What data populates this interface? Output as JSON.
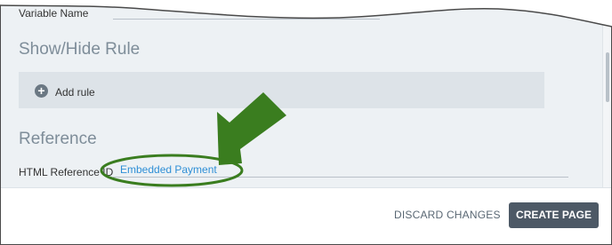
{
  "variable_field": {
    "label": "Variable Name"
  },
  "show_hide_rule": {
    "title": "Show/Hide Rule",
    "add_rule_label": "Add rule",
    "add_icon": "plus-circle-icon"
  },
  "reference": {
    "title": "Reference",
    "html_reference_label": "HTML Reference ID",
    "html_reference_value": "Embedded Payment"
  },
  "footer": {
    "discard_label": "DISCARD CHANGES",
    "create_label": "CREATE PAGE"
  },
  "annotation": {
    "arrow_icon": "green-arrow-icon",
    "highlight_icon": "green-ellipse-highlight",
    "color": "#3a7d1f"
  },
  "colors": {
    "panel_bg": "#edf1f4",
    "section_title": "#7e8d99",
    "link_value": "#2f8fd6",
    "primary_button": "#4d5966"
  }
}
